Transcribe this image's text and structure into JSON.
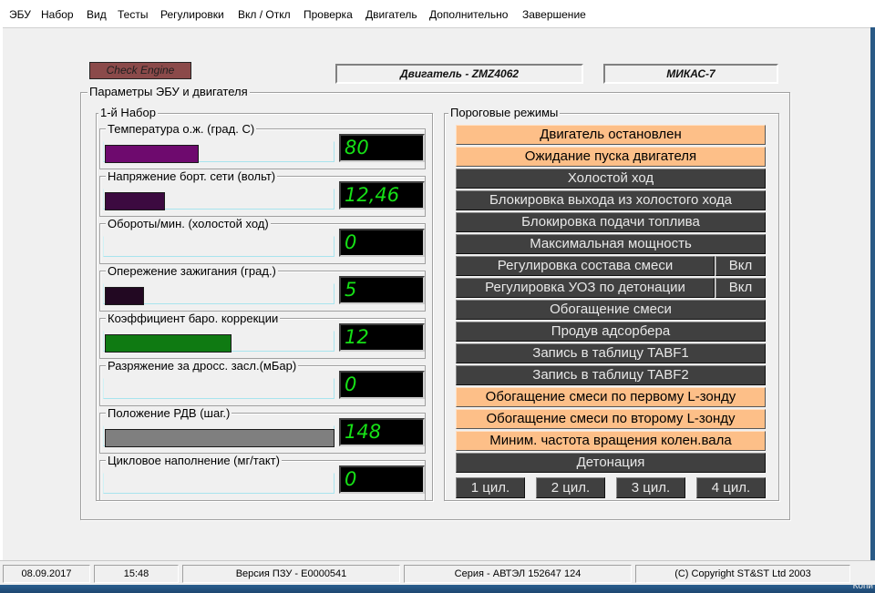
{
  "menu": [
    "ЭБУ",
    "Набор",
    "Вид",
    "Тесты",
    "Регулировки",
    "Вкл / Откл",
    "Проверка",
    "Двигатель",
    "Дополнительно",
    "Завершение"
  ],
  "header": {
    "check_engine": "Check Engine",
    "engine": "Двигатель - ZMZ4062",
    "ecu": "МИКАС-7"
  },
  "params_group": {
    "title": "Параметры ЭБУ и двигателя",
    "set_title": "1-й  Набор",
    "items": [
      {
        "label": "Температура  о.ж. (град. С)",
        "value": "80",
        "level_percent": 41,
        "color": "#6e0a6e"
      },
      {
        "label": "Напряжение борт. сети (вольт)",
        "value": "12,46",
        "level_percent": 26,
        "color": "#3c0a40"
      },
      {
        "label": "Обороты/мин. (холостой ход)",
        "value": "0",
        "level_percent": 0,
        "color": "#3c0a40"
      },
      {
        "label": "Опережение зажигания (град.)",
        "value": "5",
        "level_percent": 17,
        "color": "#220822"
      },
      {
        "label": "Коэффициент баро. коррекции",
        "value": "12",
        "level_percent": 55,
        "color": "#0f7a12"
      },
      {
        "label": "Разряжение за дросс. засл.(мБар)",
        "value": "0",
        "level_percent": 0,
        "color": "#3c0a40"
      },
      {
        "label": "Положение РДВ (шаг.)",
        "value": "148",
        "level_percent": 100,
        "color": "#7f7f7f"
      },
      {
        "label": "Цикловое наполнение (мг/такт)",
        "value": "0",
        "level_percent": 0,
        "color": "#3c0a40"
      }
    ]
  },
  "modes_group": {
    "title": "Пороговые режимы",
    "modes": [
      {
        "label": "Двигатель остановлен",
        "active": true
      },
      {
        "label": "Ожидание пуска двигателя",
        "active": true
      },
      {
        "label": "Холостой ход",
        "active": false
      },
      {
        "label": "Блокировка выхода из холостого хода",
        "active": false
      },
      {
        "label": "Блокировка подачи топлива",
        "active": false
      },
      {
        "label": "Максимальная мощность",
        "active": false
      },
      {
        "label": "Регулировка состава смеси",
        "active": false,
        "toggle": "Вкл"
      },
      {
        "label": "Регулировка УОЗ по детонации",
        "active": false,
        "toggle": "Вкл"
      },
      {
        "label": "Обогащение смеси",
        "active": false
      },
      {
        "label": "Продув адсорбера",
        "active": false
      },
      {
        "label": "Запись в таблицу TABF1",
        "active": false
      },
      {
        "label": "Запись в таблицу TABF2",
        "active": false
      },
      {
        "label": "Обогащение смеси по первому L-зонду",
        "active": true
      },
      {
        "label": "Обогащение смеси по второму L-зонду",
        "active": true
      },
      {
        "label": "Миним. частота вращения колен.вала",
        "active": true
      },
      {
        "label": "Детонация",
        "active": false
      }
    ],
    "cylinders": [
      "1 цил.",
      "2 цил.",
      "3 цил.",
      "4 цил."
    ]
  },
  "status": {
    "date": "08.09.2017",
    "time": "15:48",
    "rom_version": "Версия ПЗУ - E0000541",
    "serial": "Серия - АВТЭЛ 152647 124",
    "copyright": "(C) Copyright   ST&ST  Ltd 2003"
  },
  "corner_text": "Копи",
  "colors": {
    "mode_active": "#fdbf88",
    "mode_inactive": "#404040",
    "value_digits": "#16e016",
    "check_engine": "#8b4a4a"
  }
}
